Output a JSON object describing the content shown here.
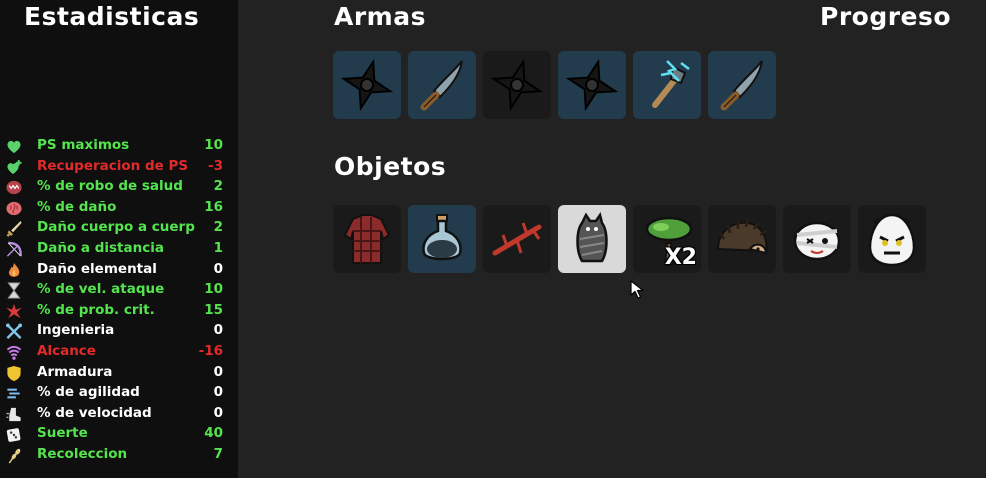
{
  "colors": {
    "positive": "#54e54e",
    "negative": "#e32a2a",
    "neutral": "#ffffff",
    "slot_tier1": "#223b4d",
    "slot_common": "#1a1a1a",
    "slot_selected": "#d9d9d9"
  },
  "stats_panel": {
    "title": "Estadisticas",
    "stats": [
      {
        "label": "PS maximos",
        "value": "10",
        "status": "positive",
        "icon": "heart-icon"
      },
      {
        "label": "Recuperacion de PS",
        "value": "-3",
        "status": "negative",
        "icon": "heart-regen-icon"
      },
      {
        "label": "% de robo de salud",
        "value": "2",
        "status": "positive",
        "icon": "lifesteal-mouth-icon"
      },
      {
        "label": "% de daño",
        "value": "16",
        "status": "positive",
        "icon": "brain-damage-icon"
      },
      {
        "label": "Daño cuerpo a cuerp",
        "value": "2",
        "status": "positive",
        "icon": "sword-icon"
      },
      {
        "label": "Daño a distancia",
        "value": "1",
        "status": "positive",
        "icon": "bow-icon"
      },
      {
        "label": "Daño elemental",
        "value": "0",
        "status": "neutral",
        "icon": "flame-icon"
      },
      {
        "label": "% de vel. ataque",
        "value": "10",
        "status": "positive",
        "icon": "hourglass-icon"
      },
      {
        "label": "% de prob. crit.",
        "value": "15",
        "status": "positive",
        "icon": "crit-burst-icon"
      },
      {
        "label": "Ingenieria",
        "value": "0",
        "status": "neutral",
        "icon": "wrench-cross-icon"
      },
      {
        "label": "Alcance",
        "value": "-16",
        "status": "negative",
        "icon": "range-wave-icon"
      },
      {
        "label": "Armadura",
        "value": "0",
        "status": "neutral",
        "icon": "shield-icon"
      },
      {
        "label": "% de agilidad",
        "value": "0",
        "status": "neutral",
        "icon": "dodge-wind-icon"
      },
      {
        "label": "% de velocidad",
        "value": "0",
        "status": "neutral",
        "icon": "boot-speed-icon"
      },
      {
        "label": "Suerte",
        "value": "40",
        "status": "positive",
        "icon": "dice-icon"
      },
      {
        "label": "Recoleccion",
        "value": "7",
        "status": "positive",
        "icon": "wheat-icon"
      }
    ]
  },
  "weapons": {
    "title": "Armas",
    "slots": [
      {
        "icon": "shuriken-icon",
        "tier": "t1"
      },
      {
        "icon": "knife-icon",
        "tier": "t1"
      },
      {
        "icon": "shuriken-icon",
        "tier": "common"
      },
      {
        "icon": "shuriken-icon",
        "tier": "t1"
      },
      {
        "icon": "lightning-wrench-icon",
        "tier": "t1"
      },
      {
        "icon": "knife-icon",
        "tier": "t1"
      }
    ]
  },
  "progress_link": "Progreso",
  "items": {
    "title": "Objetos",
    "slots": [
      {
        "icon": "plaid-shirt-icon",
        "tier": "common",
        "count": ""
      },
      {
        "icon": "potion-flask-icon",
        "tier": "t1",
        "count": ""
      },
      {
        "icon": "thorny-branch-icon",
        "tier": "common",
        "count": ""
      },
      {
        "icon": "bat-mummy-icon",
        "tier": "selected",
        "count": ""
      },
      {
        "icon": "tree-icon",
        "tier": "common",
        "count": "X2"
      },
      {
        "icon": "hedgehog-icon",
        "tier": "common",
        "count": ""
      },
      {
        "icon": "bandaged-creature-icon",
        "tier": "common",
        "count": ""
      },
      {
        "icon": "angry-egg-icon",
        "tier": "common",
        "count": ""
      }
    ]
  }
}
